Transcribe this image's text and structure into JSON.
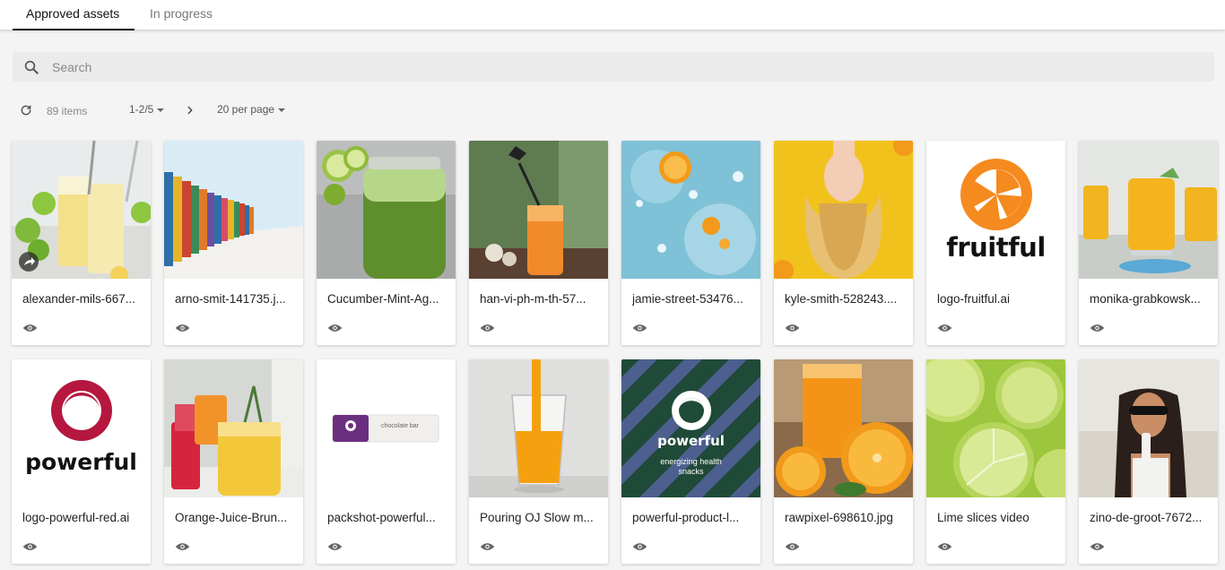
{
  "tabs": [
    {
      "label": "Approved assets",
      "active": true
    },
    {
      "label": "In progress",
      "active": false
    }
  ],
  "search": {
    "placeholder": "Search",
    "value": ""
  },
  "toolbar": {
    "item_count": "89 items",
    "pagination": "1-2/5",
    "per_page": "20 per page"
  },
  "assets": [
    {
      "title": "alexander-mils-667...",
      "thumb": "lemonade-glasses"
    },
    {
      "title": "arno-smit-141735.j...",
      "thumb": "beach-huts"
    },
    {
      "title": "Cucumber-Mint-Ag...",
      "thumb": "cucumber-jar"
    },
    {
      "title": "han-vi-ph-m-th-57...",
      "thumb": "orange-cocktail"
    },
    {
      "title": "jamie-street-53476...",
      "thumb": "orange-splash"
    },
    {
      "title": "kyle-smith-528243....",
      "thumb": "woman-yellow"
    },
    {
      "title": "logo-fruitful.ai",
      "thumb": "fruitful-logo"
    },
    {
      "title": "monika-grabkowsk...",
      "thumb": "yellow-cocktails"
    },
    {
      "title": "logo-powerful-red.ai",
      "thumb": "powerful-logo"
    },
    {
      "title": "Orange-Juice-Brun...",
      "thumb": "brunch-drinks"
    },
    {
      "title": "packshot-powerful...",
      "thumb": "chocolate-bar"
    },
    {
      "title": "Pouring OJ Slow m...",
      "thumb": "pouring-oj"
    },
    {
      "title": "powerful-product-l...",
      "thumb": "powerful-product"
    },
    {
      "title": "rawpixel-698610.jpg",
      "thumb": "orange-juice"
    },
    {
      "title": "Lime slices video",
      "thumb": "lime-slices"
    },
    {
      "title": "zino-de-groot-7672...",
      "thumb": "woman-drink"
    }
  ],
  "logos": {
    "fruitful": "fruitful",
    "powerful": "powerful",
    "product_tagline": "energizing health snacks",
    "bar_label": "chocolate bar"
  },
  "colors": {
    "fruitful_orange": "#f58a1f",
    "powerful_red": "#b5173f",
    "powerful_green": "#1f4a37",
    "powerful_blue": "#4d5f8f"
  }
}
